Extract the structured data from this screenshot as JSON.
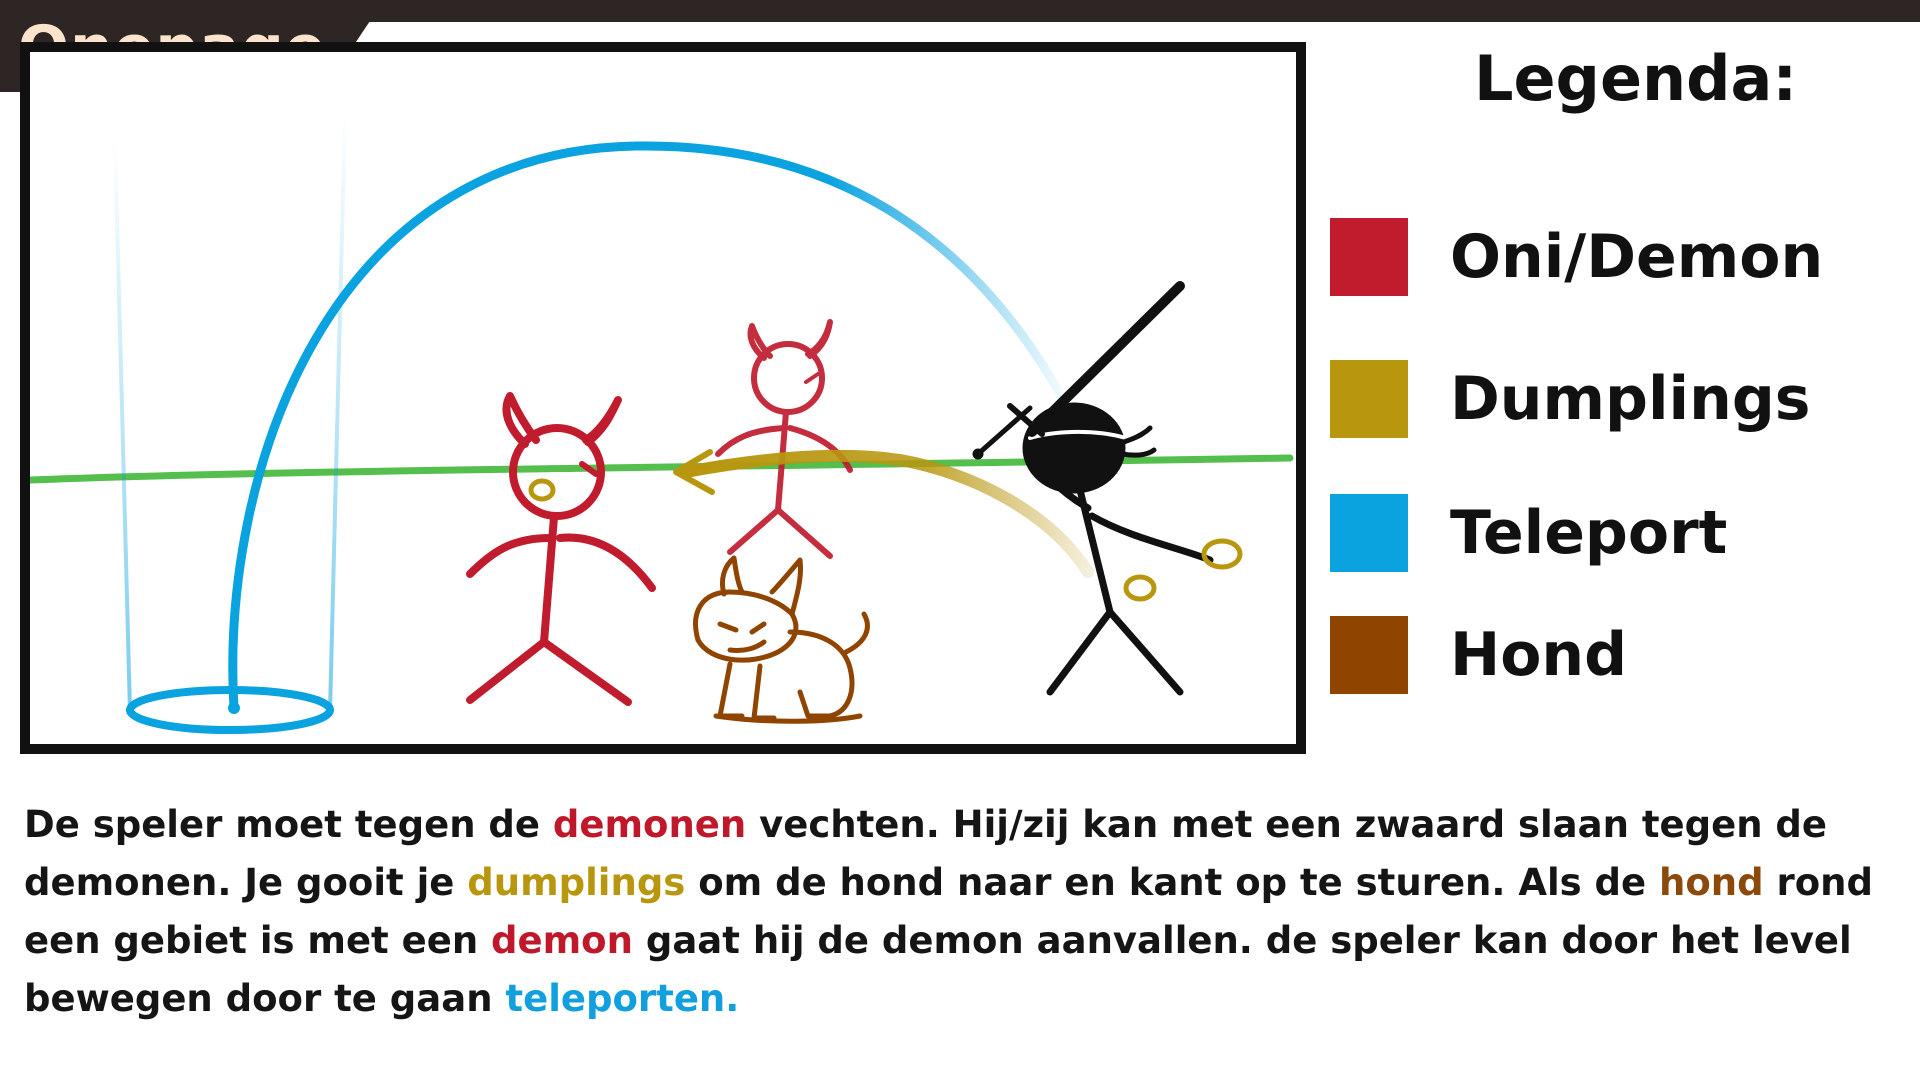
{
  "header": {
    "title": "Onepage"
  },
  "legend": {
    "title": "Legenda:",
    "items": [
      {
        "label": "Oni/Demon",
        "color": "#c01c2e"
      },
      {
        "label": "Dumplings",
        "color": "#b8960e"
      },
      {
        "label": "Teleport",
        "color": "#0aa3e0"
      },
      {
        "label": "Hond",
        "color": "#8f4400"
      }
    ]
  },
  "description": {
    "s1": "De speler moet tegen de ",
    "k1": "demonen",
    "s2": " vechten. Hij/zij kan met een zwaard slaan tegen de demonen. Je gooit je ",
    "k2": "dumplings",
    "s3": " om de hond naar en kant op te sturen. Als de ",
    "k3": "hond",
    "s4": " rond een gebiet is met een ",
    "k4": "demon",
    "s5": " gaat hij de demon aanvallen. de speler kan door het level bewegen door te gaan ",
    "k5": "teleporten."
  },
  "colors": {
    "demon": "#c01c2e",
    "dumplings": "#b8960e",
    "teleport": "#0aa3e0",
    "dog": "#8f4400",
    "ground": "#43b83b",
    "player": "#111111"
  },
  "scene": {
    "figures": [
      "teleport-portal-icon",
      "demon-figure-icon",
      "dog-figure-icon",
      "ninja-player-icon",
      "sword-icon",
      "dumpling-icon"
    ]
  }
}
